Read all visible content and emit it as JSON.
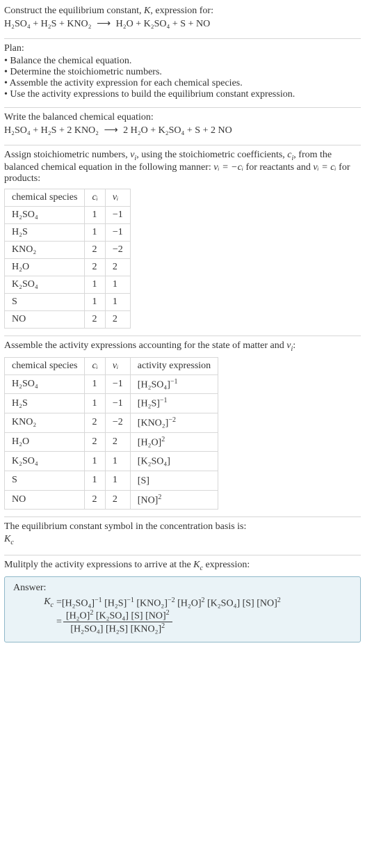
{
  "header": {
    "title_pre": "Construct the equilibrium constant, ",
    "k_sym": "K",
    "title_post": ", expression for:",
    "eq_lhs": "H₂SO₄ + H₂S + KNO₂",
    "arrow": "⟶",
    "eq_rhs": "H₂O + K₂SO₄ + S + NO"
  },
  "plan": {
    "label": "Plan:",
    "items": [
      "Balance the chemical equation.",
      "Determine the stoichiometric numbers.",
      "Assemble the activity expression for each chemical species.",
      "Use the activity expressions to build the equilibrium constant expression."
    ]
  },
  "balanced": {
    "intro": "Write the balanced chemical equation:",
    "eq_lhs": "H₂SO₄ + H₂S + 2 KNO₂",
    "arrow": "⟶",
    "eq_rhs": "2 H₂O + K₂SO₄ + S + 2 NO"
  },
  "stoich": {
    "intro_a": "Assign stoichiometric numbers, ",
    "nu": "ν",
    "nu_sub": "i",
    "intro_b": ", using the stoichiometric coefficients, ",
    "c": "c",
    "c_sub": "i",
    "intro_c": ", from the balanced chemical equation in the following manner: ",
    "rel1": "νᵢ = −cᵢ",
    "intro_d": " for reactants and ",
    "rel2": "νᵢ = cᵢ",
    "intro_e": " for products:",
    "headers": {
      "species": "chemical species",
      "ci": "cᵢ",
      "vi": "νᵢ"
    },
    "rows": [
      {
        "species": "H₂SO₄",
        "ci": "1",
        "vi": "−1"
      },
      {
        "species": "H₂S",
        "ci": "1",
        "vi": "−1"
      },
      {
        "species": "KNO₂",
        "ci": "2",
        "vi": "−2"
      },
      {
        "species": "H₂O",
        "ci": "2",
        "vi": "2"
      },
      {
        "species": "K₂SO₄",
        "ci": "1",
        "vi": "1"
      },
      {
        "species": "S",
        "ci": "1",
        "vi": "1"
      },
      {
        "species": "NO",
        "ci": "2",
        "vi": "2"
      }
    ]
  },
  "activity": {
    "intro_a": "Assemble the activity expressions accounting for the state of matter and ",
    "nu": "ν",
    "nu_sub": "i",
    "intro_b": ":",
    "headers": {
      "species": "chemical species",
      "ci": "cᵢ",
      "vi": "νᵢ",
      "ae": "activity expression"
    },
    "rows": [
      {
        "species": "H₂SO₄",
        "ci": "1",
        "vi": "−1",
        "ae_base": "[H₂SO₄]",
        "ae_exp": "−1"
      },
      {
        "species": "H₂S",
        "ci": "1",
        "vi": "−1",
        "ae_base": "[H₂S]",
        "ae_exp": "−1"
      },
      {
        "species": "KNO₂",
        "ci": "2",
        "vi": "−2",
        "ae_base": "[KNO₂]",
        "ae_exp": "−2"
      },
      {
        "species": "H₂O",
        "ci": "2",
        "vi": "2",
        "ae_base": "[H₂O]",
        "ae_exp": "2"
      },
      {
        "species": "K₂SO₄",
        "ci": "1",
        "vi": "1",
        "ae_base": "[K₂SO₄]",
        "ae_exp": ""
      },
      {
        "species": "S",
        "ci": "1",
        "vi": "1",
        "ae_base": "[S]",
        "ae_exp": ""
      },
      {
        "species": "NO",
        "ci": "2",
        "vi": "2",
        "ae_base": "[NO]",
        "ae_exp": "2"
      }
    ]
  },
  "basis": {
    "line1": "The equilibrium constant symbol in the concentration basis is:",
    "sym_main": "K",
    "sym_sub": "c"
  },
  "multiply": {
    "intro_a": "Mulitply the activity expressions to arrive at the ",
    "sym_main": "K",
    "sym_sub": "c",
    "intro_b": " expression:"
  },
  "answer": {
    "label": "Answer:",
    "kc_main": "K",
    "kc_sub": "c",
    "eq": " = ",
    "terms": [
      {
        "base": "[H₂SO₄]",
        "exp": "−1"
      },
      {
        "base": "[H₂S]",
        "exp": "−1"
      },
      {
        "base": "[KNO₂]",
        "exp": "−2"
      },
      {
        "base": "[H₂O]",
        "exp": "2"
      },
      {
        "base": "[K₂SO₄]",
        "exp": ""
      },
      {
        "base": "[S]",
        "exp": ""
      },
      {
        "base": "[NO]",
        "exp": "2"
      }
    ],
    "eq2": "= ",
    "num": [
      {
        "base": "[H₂O]",
        "exp": "2"
      },
      {
        "base": "[K₂SO₄]",
        "exp": ""
      },
      {
        "base": "[S]",
        "exp": ""
      },
      {
        "base": "[NO]",
        "exp": "2"
      }
    ],
    "den": [
      {
        "base": "[H₂SO₄]",
        "exp": ""
      },
      {
        "base": "[H₂S]",
        "exp": ""
      },
      {
        "base": "[KNO₂]",
        "exp": "2"
      }
    ]
  }
}
